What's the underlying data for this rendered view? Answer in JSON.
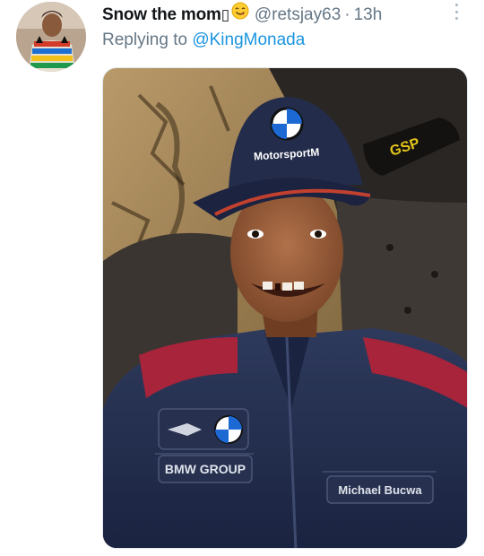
{
  "tweet": {
    "display_name": "Snow the mom",
    "display_name_glyph": "▯",
    "handle": "@retsjay63",
    "separator": "·",
    "time": "13h",
    "replying_prefix": "Replying to ",
    "replying_to": "@KingMonada"
  },
  "avatar": {
    "icon": "profile-photo"
  },
  "emoji": {
    "icon": "yum-face-emoji"
  },
  "more": {
    "icon": "more-vertical-icon"
  },
  "photo": {
    "description_icons": [
      "bmw-roundel-logo",
      "mini-wings-logo"
    ],
    "cap_text": "MotorsportM",
    "jacket_left_text": "BMW GROUP",
    "jacket_right_text": "Michael Bucwa",
    "bottle_text": "GSP"
  },
  "colors": {
    "link": "#1b95e0",
    "secondary_text": "#657786",
    "primary_text": "#14171a"
  }
}
